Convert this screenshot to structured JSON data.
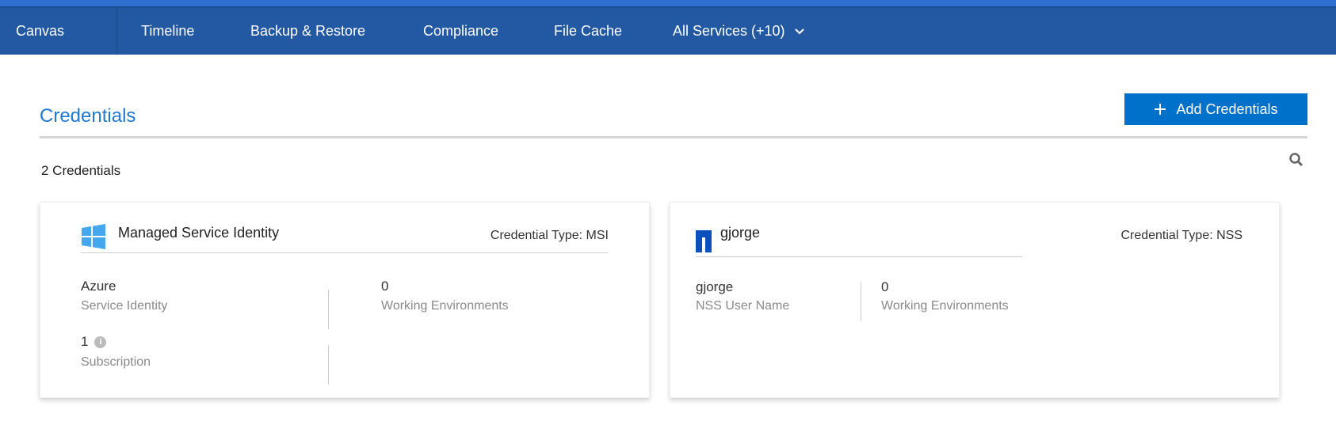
{
  "nav": {
    "items": [
      "Canvas",
      "Timeline",
      "Backup & Restore",
      "Compliance",
      "File Cache",
      "All Services (+10)"
    ]
  },
  "page": {
    "title": "Credentials",
    "add_button": "Add Credentials",
    "count": "2 Credentials"
  },
  "cards": [
    {
      "name": "Managed Service Identity",
      "type": "Credential Type: MSI",
      "icon": "windows-icon",
      "fields": [
        {
          "value": "Azure",
          "label": "Service Identity"
        },
        {
          "value": "0",
          "label": "Working Environments"
        },
        {
          "value": "1",
          "label": "Subscription"
        }
      ]
    },
    {
      "name": "gjorge",
      "type": "Credential Type: NSS",
      "icon": "netapp-icon",
      "fields": [
        {
          "value": "gjorge",
          "label": "NSS User Name"
        },
        {
          "value": "0",
          "label": "Working Environments"
        }
      ]
    }
  ],
  "colors": {
    "nav": "#2358a3",
    "accent": "#0071ca",
    "title": "#1f7ad1"
  }
}
